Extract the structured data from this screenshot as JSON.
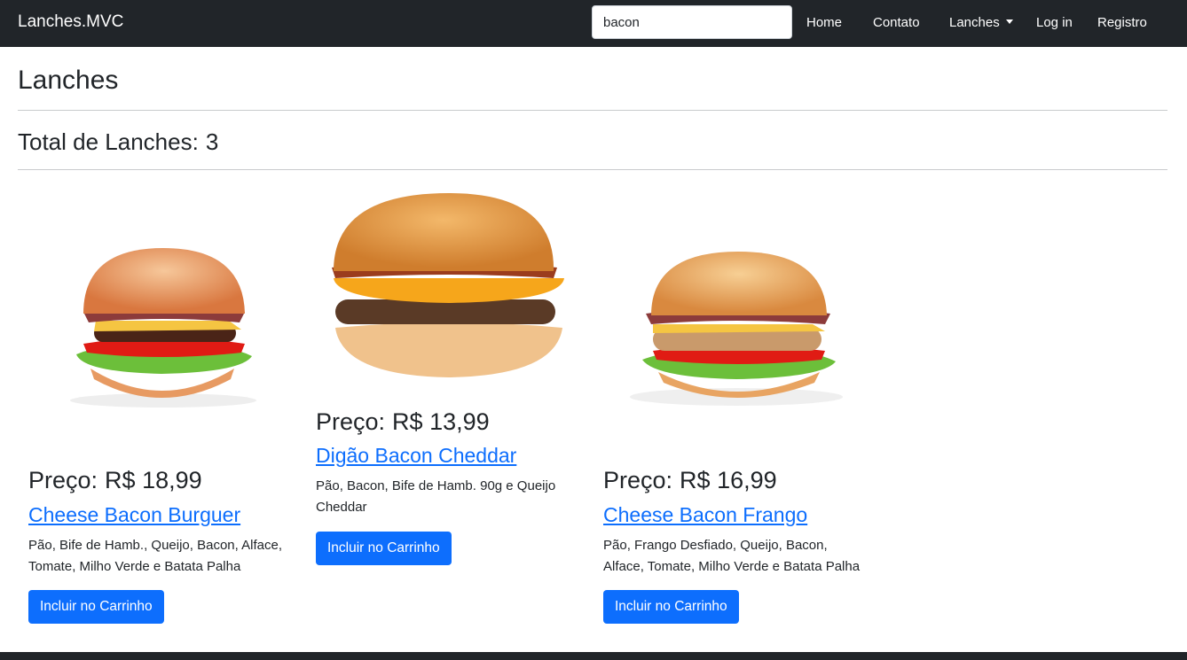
{
  "navbar": {
    "brand": "Lanches.MVC",
    "search_value": "bacon",
    "links": {
      "home": "Home",
      "contato": "Contato",
      "lanches": "Lanches",
      "login": "Log in",
      "registro": "Registro"
    }
  },
  "page": {
    "title": "Lanches",
    "total_label": "Total de Lanches:",
    "total_count": "3"
  },
  "products": [
    {
      "price_label": "Preço:",
      "price": "R$ 18,99",
      "name": "Cheese Bacon Burguer",
      "description": "Pão, Bife de Hamb., Queijo, Bacon, Alface, Tomate, Milho Verde e Batata Palha",
      "button": "Incluir no Carrinho"
    },
    {
      "price_label": "Preço:",
      "price": "R$ 13,99",
      "name": "Digão Bacon Cheddar",
      "description": "Pão, Bacon, Bife de Hamb. 90g e Queijo Cheddar",
      "button": "Incluir no Carrinho"
    },
    {
      "price_label": "Preço:",
      "price": "R$ 16,99",
      "name": "Cheese Bacon Frango",
      "description": "Pão, Frango Desfiado, Queijo, Bacon, Alface, Tomate, Milho Verde e Batata Palha",
      "button": "Incluir no Carrinho"
    }
  ],
  "colors": {
    "navbar_bg": "#212529",
    "primary": "#0d6efd",
    "link": "#0d6efd",
    "text": "#212529"
  }
}
